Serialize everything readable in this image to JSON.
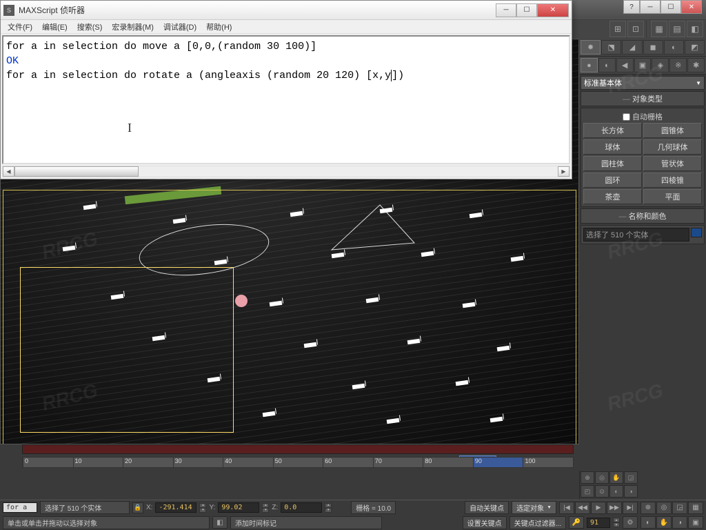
{
  "watermark": "RRCG",
  "bg_window": {
    "help_btn": "?",
    "min_btn": "─",
    "max_btn": "☐",
    "close_btn": "✕"
  },
  "listener": {
    "title": "MAXScript 侦听器",
    "menu": [
      "文件(F)",
      "编辑(E)",
      "搜索(S)",
      "宏录制器(M)",
      "调试器(D)",
      "帮助(H)"
    ],
    "code_line1": "for a in selection do move a [0,0,(random 30 100)]",
    "code_line2": "OK",
    "code_line3_a": "for a in selection do rotate a (angleaxis (random 20 120) [x,y",
    "code_line3_b": "])",
    "min_btn": "─",
    "max_btn": "☐",
    "close_btn": "✕"
  },
  "command_panel": {
    "tabs_row1": [
      "✹",
      "⬔",
      "◢",
      "◼",
      "◐",
      "◩"
    ],
    "tabs_row2": [
      "●",
      "◐",
      "◀",
      "▣",
      "◈",
      "※",
      "✱"
    ],
    "category_dropdown": "标准基本体",
    "object_type_header": "对象类型",
    "auto_grid": "自动栅格",
    "buttons": [
      {
        "l": "长方体",
        "r": "圆锥体"
      },
      {
        "l": "球体",
        "r": "几何球体"
      },
      {
        "l": "圆柱体",
        "r": "管状体"
      },
      {
        "l": "圆环",
        "r": "四棱锥"
      },
      {
        "l": "茶壶",
        "r": "平面"
      }
    ],
    "name_color_header": "名称和颜色",
    "name_input": "选择了 510 个实体"
  },
  "viewport": {
    "active": true
  },
  "timeline": {
    "frame_indicator": "91 / 100",
    "ticks": [
      "0",
      "10",
      "20",
      "30",
      "40",
      "50",
      "60",
      "70",
      "80",
      "90",
      "100"
    ]
  },
  "status": {
    "mini_cmd": "for a",
    "selection": "选择了 510 个实体",
    "lock": "🔒",
    "x_label": "X:",
    "x_val": "-291.414",
    "y_label": "Y:",
    "y_val": "99.02",
    "z_label": "Z:",
    "z_val": "0.0",
    "grid": "栅格 = 10.0",
    "autokey": "自动关键点",
    "keymode": "选定对象",
    "setkey": "设置关键点",
    "keyfilter": "关键点过滤器...",
    "prompt": "单击或单击并拖动以选择对象",
    "addtime": "添加时间标记"
  },
  "playback": {
    "prev_key": "|◀",
    "prev": "◀◀",
    "play": "▶",
    "next": "▶▶",
    "next_key": "▶|",
    "cur_frame": "91"
  },
  "nav_icons": [
    "⊕",
    "◎",
    "✋",
    "◲",
    "◰",
    "⊙",
    "◐",
    "◑"
  ]
}
